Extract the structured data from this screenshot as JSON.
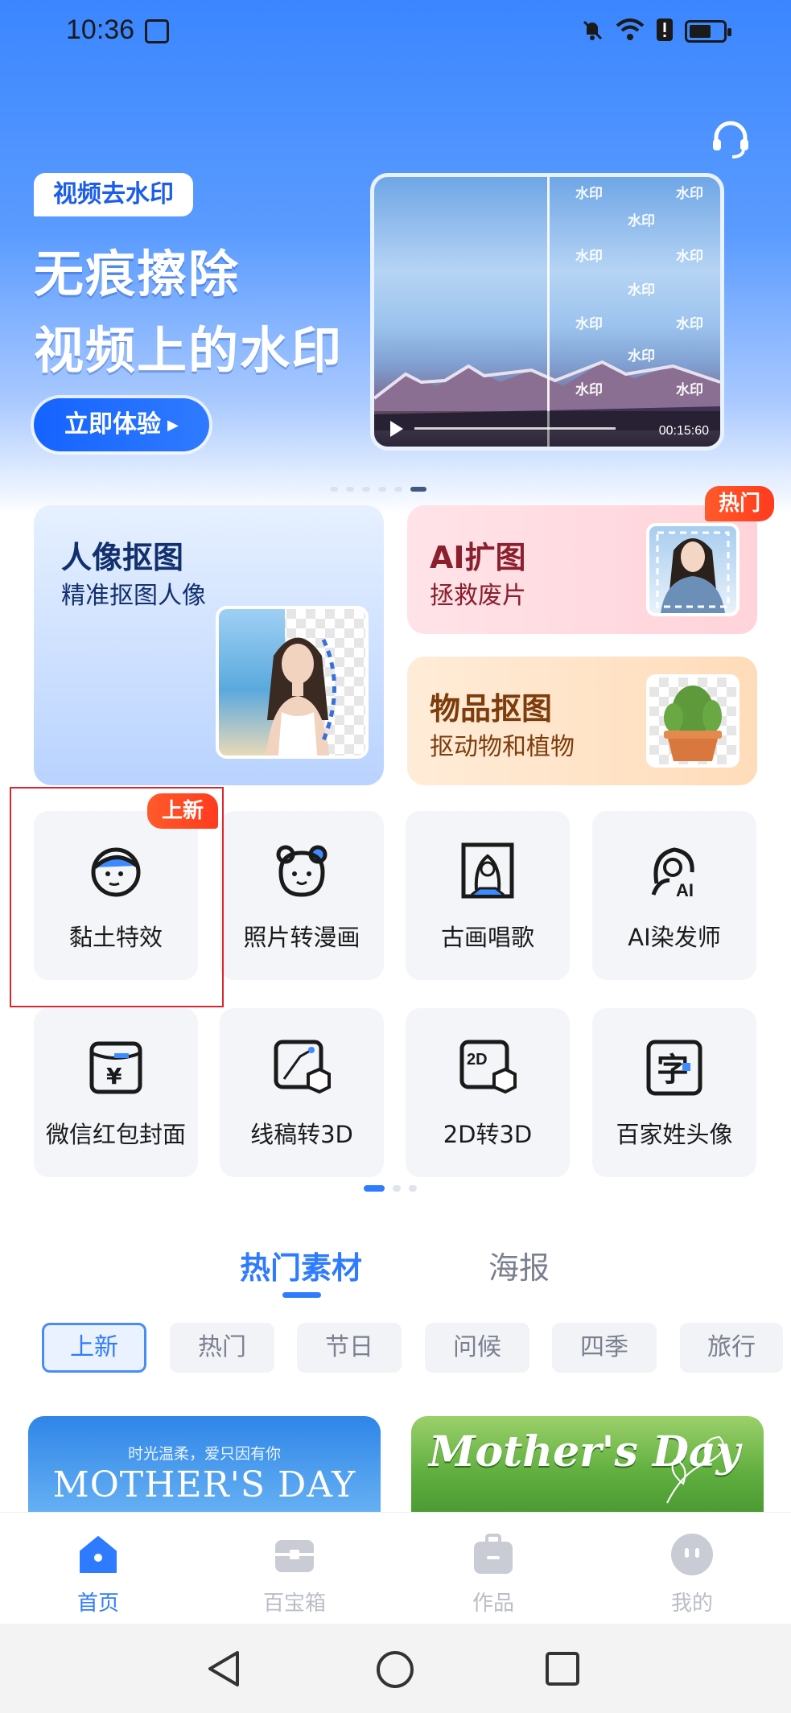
{
  "status": {
    "time": "10:36"
  },
  "hero": {
    "tag": "视频去水印",
    "title_line1": "无痕擦除",
    "title_line2": "视频上的水印",
    "cta": "立即体验",
    "watermark_text": "水印",
    "video_time": "00:15:60"
  },
  "features": {
    "portrait": {
      "title": "人像抠图",
      "subtitle": "精准抠图人像"
    },
    "expand": {
      "title": "AI扩图",
      "subtitle": "拯救废片",
      "badge": "热门"
    },
    "object": {
      "title": "物品抠图",
      "subtitle": "抠动物和植物"
    }
  },
  "tools": {
    "new_badge": "上新",
    "row1": [
      {
        "label": "黏土特效",
        "icon": "clay-face-icon"
      },
      {
        "label": "照片转漫画",
        "icon": "bear-icon"
      },
      {
        "label": "古画唱歌",
        "icon": "portrait-frame-icon"
      },
      {
        "label": "AI染发师",
        "icon": "ai-hair-icon"
      }
    ],
    "row2": [
      {
        "label": "微信红包封面",
        "icon": "red-packet-icon"
      },
      {
        "label": "线稿转3D",
        "icon": "sketch-3d-icon"
      },
      {
        "label": "2D转3D",
        "icon": "2d-3d-icon"
      },
      {
        "label": "百家姓头像",
        "icon": "surname-icon"
      }
    ]
  },
  "materials": {
    "tabs": [
      "热门素材",
      "海报"
    ],
    "chips": [
      "上新",
      "热门",
      "节日",
      "问候",
      "四季",
      "旅行"
    ],
    "poster1": {
      "small": "时光温柔，爱只因有你",
      "big": "MOTHER'S DAY"
    },
    "poster2": {
      "script": "Mother's Day"
    }
  },
  "nav": [
    "首页",
    "百宝箱",
    "作品",
    "我的"
  ],
  "colors": {
    "accent": "#2f7bff",
    "hot": "#ff3b1f"
  }
}
